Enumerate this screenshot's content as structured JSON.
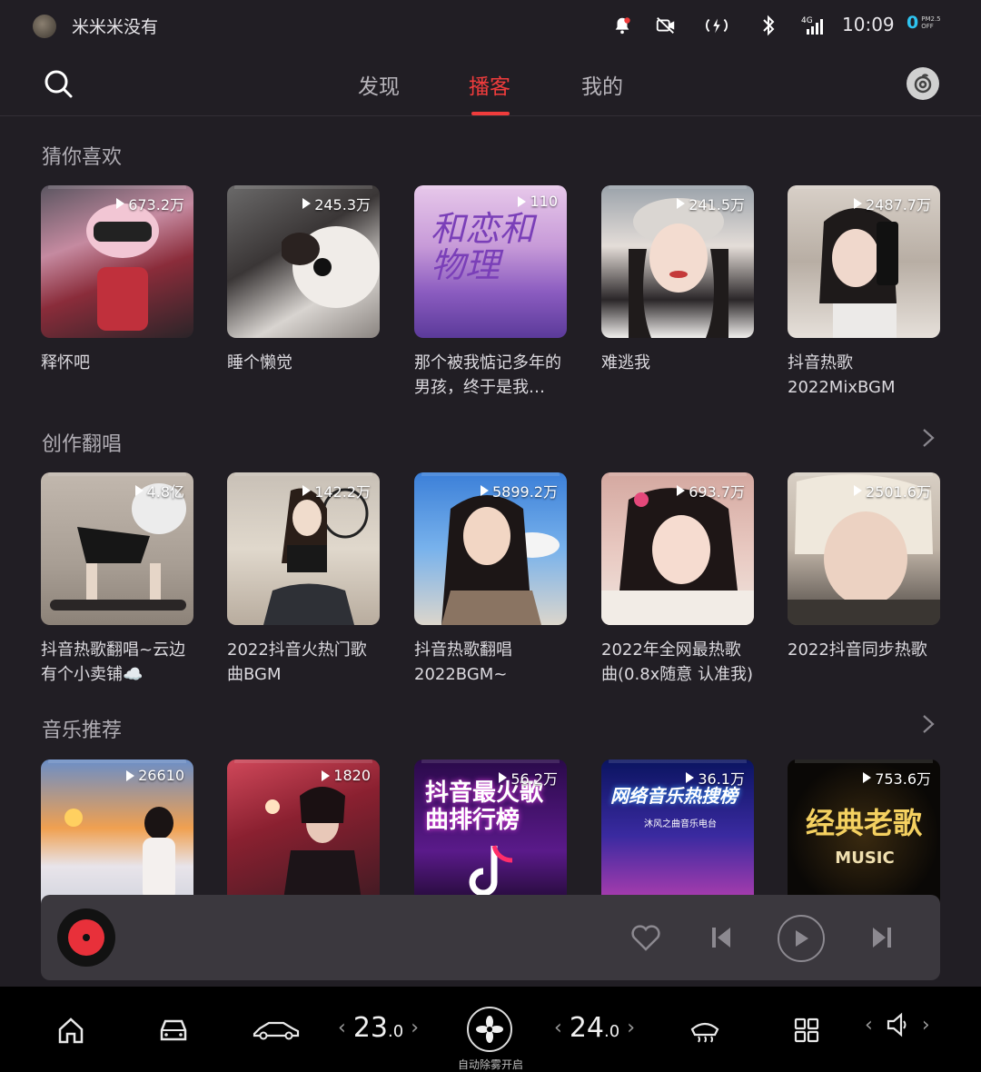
{
  "status_bar": {
    "user_name": "米米米没有",
    "time": "10:09",
    "pm_value": "0",
    "pm_label_top": "PM2.5",
    "pm_label_bottom": "OFF",
    "signal_label": "4G"
  },
  "nav": {
    "tabs": [
      {
        "label": "发现"
      },
      {
        "label": "播客"
      },
      {
        "label": "我的"
      }
    ],
    "active_tab": "播客"
  },
  "sections": [
    {
      "title": "猜你喜欢",
      "cards": [
        {
          "count": "673.2万",
          "title": "释怀吧"
        },
        {
          "count": "245.3万",
          "title": "睡个懒觉"
        },
        {
          "count": "110",
          "title": "那个被我惦记多年的男孩，终于是我…",
          "cover_text": "和恋和物理"
        },
        {
          "count": "241.5万",
          "title": "难逃我"
        },
        {
          "count": "2487.7万",
          "title": "抖音热歌2022MixBGM"
        }
      ]
    },
    {
      "title": "创作翻唱",
      "cards": [
        {
          "count": "4.8亿",
          "title": "抖音热歌翻唱~云边有个小卖铺☁️"
        },
        {
          "count": "142.2万",
          "title": "2022抖音火热门歌曲BGM"
        },
        {
          "count": "5899.2万",
          "title": "抖音热歌翻唱2022BGM~"
        },
        {
          "count": "693.7万",
          "title": "2022年全网最热歌曲(0.8x随意 认准我)"
        },
        {
          "count": "2501.6万",
          "title": "2022抖音同步热歌"
        }
      ]
    },
    {
      "title": "音乐推荐",
      "cards": [
        {
          "count": "26610",
          "title": ""
        },
        {
          "count": "1820",
          "title": ""
        },
        {
          "count": "56.2万",
          "title": "",
          "cover_text": "抖音最火歌曲排行榜"
        },
        {
          "count": "36.1万",
          "title": "",
          "cover_text": "网络音乐热搜榜",
          "cover_sub": "沐风之曲音乐电台"
        },
        {
          "count": "753.6万",
          "title": "",
          "cover_text": "经典老歌",
          "cover_sub": "MUSIC"
        }
      ]
    }
  ],
  "dock": {
    "temp_left": "23",
    "temp_left_dec": ".0",
    "temp_right": "24",
    "temp_right_dec": ".0",
    "defog_text": "自动除雾开启"
  }
}
